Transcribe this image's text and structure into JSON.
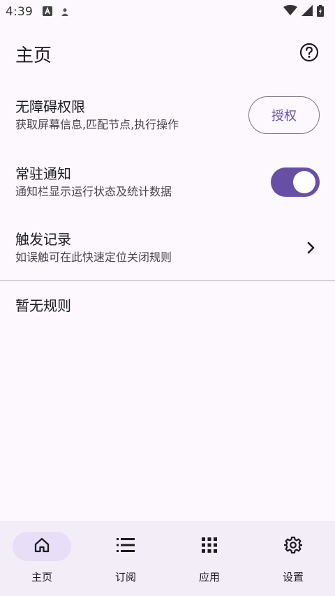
{
  "status_bar": {
    "time": "4:39",
    "icons_left": [
      "a-box-icon",
      "account-icon"
    ],
    "icons_right": [
      "wifi-icon",
      "signal-icon",
      "battery-icon"
    ]
  },
  "header": {
    "title": "主页",
    "help_icon": "help-circle-icon"
  },
  "settings": {
    "accessibility": {
      "title": "无障碍权限",
      "subtitle": "获取屏幕信息,匹配节点,执行操作",
      "button_label": "授权"
    },
    "notification": {
      "title": "常驻通知",
      "subtitle": "通知栏显示运行状态及统计数据",
      "enabled": true
    },
    "trigger_log": {
      "title": "触发记录",
      "subtitle": "如误触可在此快速定位关闭规则"
    }
  },
  "rules": {
    "empty_text": "暂无规则"
  },
  "bottom_nav": {
    "items": [
      {
        "label": "主页",
        "icon": "home-icon",
        "active": true
      },
      {
        "label": "订阅",
        "icon": "list-icon",
        "active": false
      },
      {
        "label": "应用",
        "icon": "apps-grid-icon",
        "active": false
      },
      {
        "label": "设置",
        "icon": "gear-icon",
        "active": false
      }
    ]
  },
  "colors": {
    "primary": "#6750a4",
    "background": "#fdf8fd",
    "nav_background": "#f3edf7",
    "nav_indicator": "#e8def8"
  }
}
